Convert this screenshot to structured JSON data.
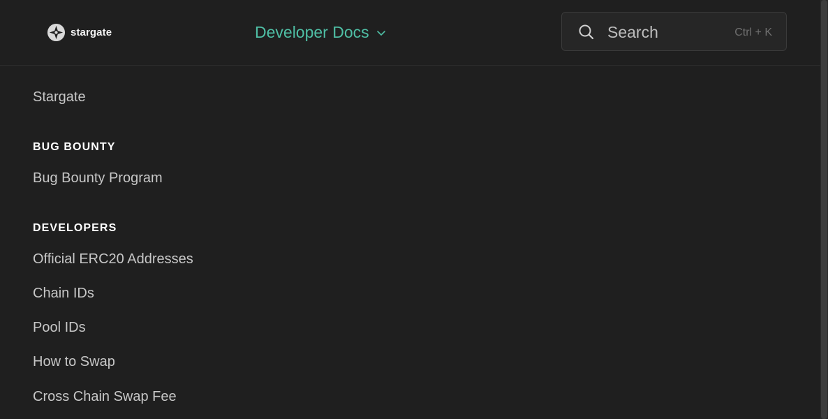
{
  "header": {
    "logo_text": "stargate",
    "logo_icon": "stargate-logo-icon",
    "space_label": "Developer Docs",
    "space_chevron_icon": "chevron-down-icon",
    "search": {
      "placeholder": "Search",
      "shortcut": "Ctrl + K",
      "icon": "search-icon"
    }
  },
  "sidebar": {
    "items": [
      {
        "type": "link",
        "label": "Stargate"
      },
      {
        "type": "heading",
        "label": "BUG BOUNTY"
      },
      {
        "type": "link",
        "label": "Bug Bounty Program"
      },
      {
        "type": "heading",
        "label": "DEVELOPERS"
      },
      {
        "type": "link",
        "label": "Official ERC20 Addresses"
      },
      {
        "type": "link",
        "label": "Chain IDs"
      },
      {
        "type": "link",
        "label": "Pool IDs"
      },
      {
        "type": "link",
        "label": "How to Swap"
      },
      {
        "type": "link",
        "label": "Cross Chain Swap Fee"
      }
    ]
  },
  "colors": {
    "background": "#1f1f1f",
    "accent": "#4fbfa5",
    "nav_text": "#c7c7c7",
    "heading_text": "#ffffff"
  }
}
